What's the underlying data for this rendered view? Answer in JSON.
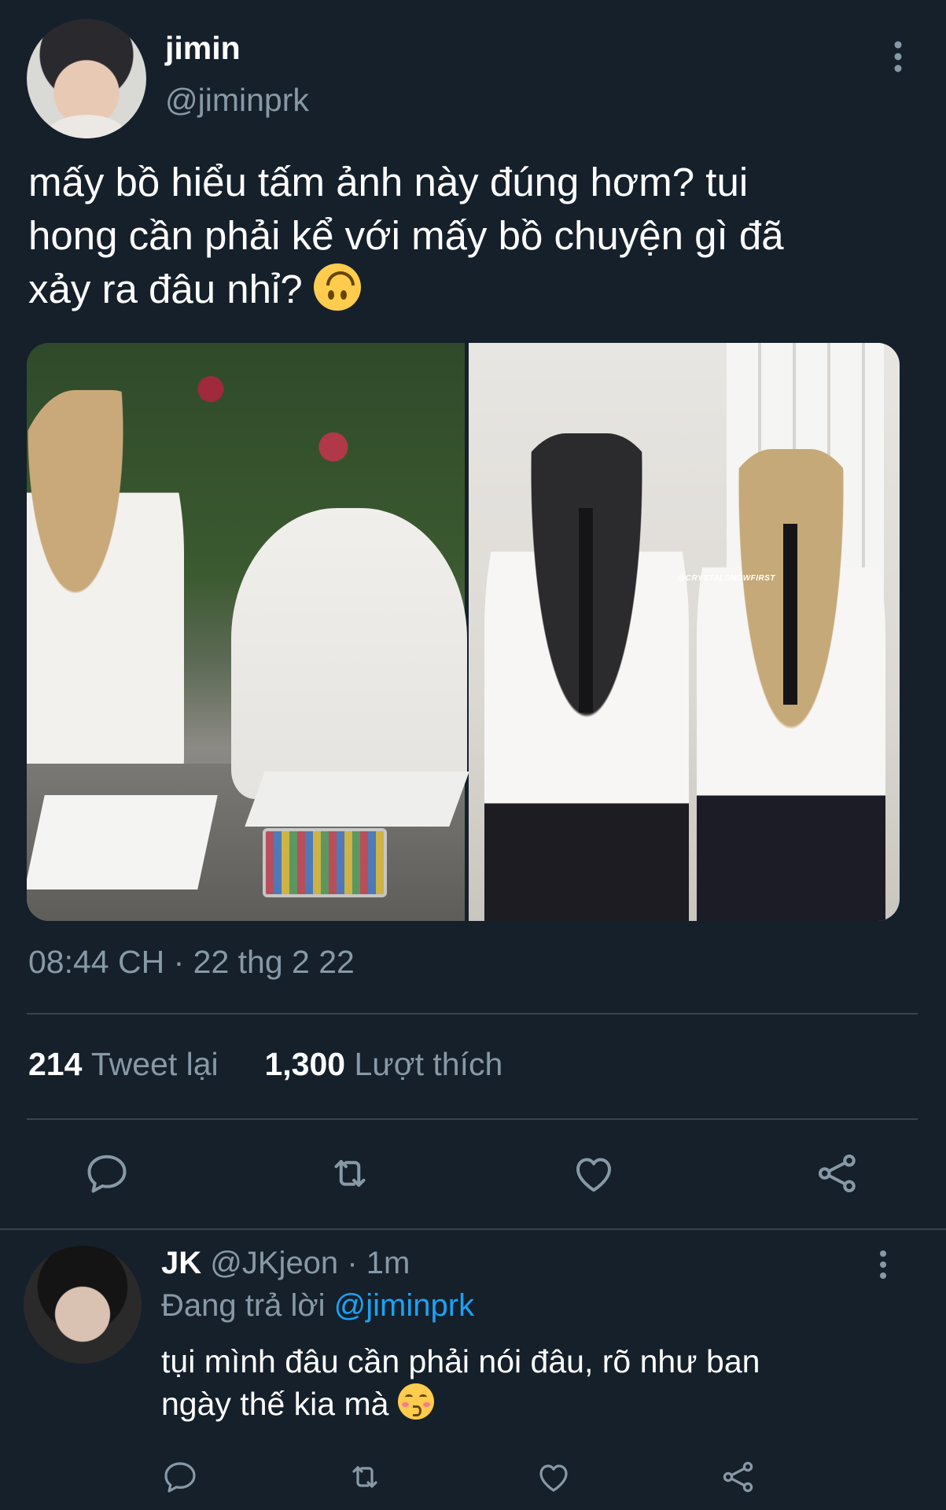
{
  "tweet": {
    "display_name": "jimin",
    "handle": "@jiminprk",
    "text_line1": "mấy bồ hiểu tấm ảnh này đúng hơm? tui",
    "text_line2": "hong cần phải kể với mấy bồ chuyện gì đã",
    "text_line3": "xảy ra đâu nhỉ?",
    "text_emoji": "upside-down-face-emoji",
    "media_watermark": "@CRYSTALSNOWFIRST",
    "timestamp": "08:44 CH · 22 thg 2 22",
    "retweet_count": "214",
    "retweet_label": "Tweet lại",
    "like_count": "1,300",
    "like_label": "Lượt thích",
    "action_icons": [
      "reply-icon",
      "retweet-icon",
      "like-icon",
      "share-icon"
    ],
    "more_icon": "more-options-icon"
  },
  "reply": {
    "display_name": "JK",
    "handle": "@JKjeon",
    "separator": "·",
    "time": "1m",
    "replying_label": "Đang trả lời",
    "replying_to": "@jiminprk",
    "text_line1": "tụi mình đâu cần phải nói đâu, rõ như ban",
    "text_line2": "ngày thế kia mà",
    "text_emoji": "kissing-face-emoji",
    "action_icons": [
      "reply-icon",
      "retweet-icon",
      "like-icon",
      "share-icon"
    ]
  },
  "colors": {
    "background": "#15202b",
    "secondary_text": "#8899a6",
    "link": "#1da1f2",
    "divider": "#38444d"
  }
}
